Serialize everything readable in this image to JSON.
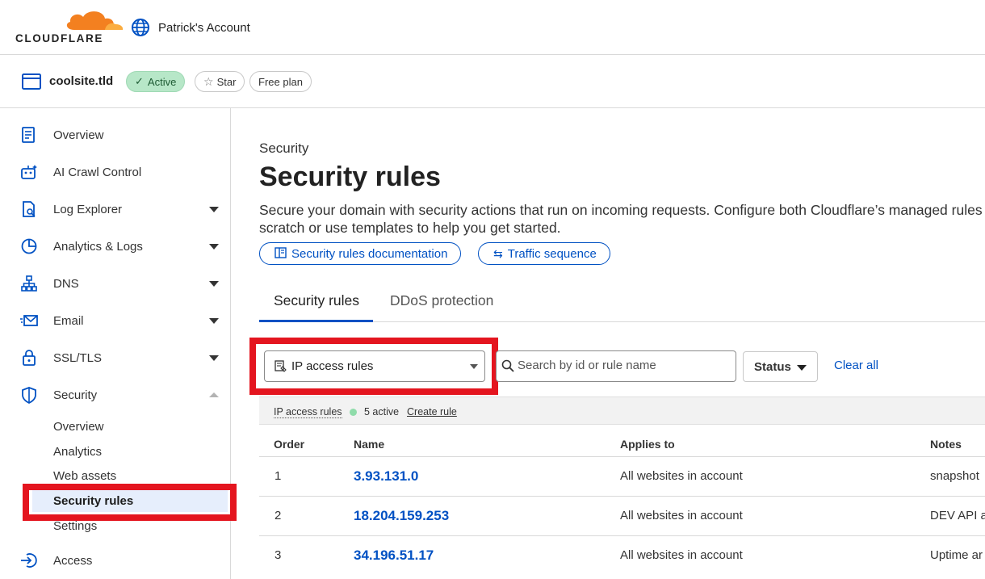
{
  "brand": {
    "logo_text": "CLOUDFLARE",
    "accent": "#f38020"
  },
  "account": {
    "name": "Patrick's Account",
    "icon": "globe-icon"
  },
  "zone": {
    "name": "coolsite.tld",
    "status": "Active",
    "star_label": "Star",
    "plan": "Free plan"
  },
  "sidebar": {
    "items": [
      {
        "label": "Overview",
        "icon": "document-icon"
      },
      {
        "label": "AI Crawl Control",
        "icon": "robot-icon"
      },
      {
        "label": "Log Explorer",
        "icon": "log-icon"
      },
      {
        "label": "Analytics & Logs",
        "icon": "pie-chart-icon"
      },
      {
        "label": "DNS",
        "icon": "network-icon"
      },
      {
        "label": "Email",
        "icon": "email-icon"
      },
      {
        "label": "SSL/TLS",
        "icon": "lock-icon"
      },
      {
        "label": "Security",
        "icon": "shield-icon"
      },
      {
        "label": "Access",
        "icon": "access-icon"
      }
    ],
    "security_sub": [
      "Overview",
      "Analytics",
      "Web assets",
      "Security rules",
      "Settings"
    ],
    "active_sub": "Security rules"
  },
  "page": {
    "breadcrumb": "Security",
    "title": "Security rules",
    "description_1": "Secure your domain with security actions that run on incoming requests. Configure both Cloudflare’s managed rules",
    "description_2": "scratch or use templates to help you get started.",
    "doc_button": "Security rules documentation",
    "traffic_button": "Traffic sequence"
  },
  "tabs": [
    "Security rules",
    "DDoS protection"
  ],
  "filters": {
    "rule_type": "IP access rules",
    "search_placeholder": "Search by id or rule name",
    "status_label": "Status",
    "clear_all": "Clear all"
  },
  "rules_bar": {
    "label": "IP access rules",
    "count": "5 active",
    "create": "Create rule"
  },
  "table": {
    "columns": [
      "Order",
      "Name",
      "Applies to",
      "Notes"
    ],
    "rows": [
      {
        "order": "1",
        "name": "3.93.131.0",
        "applies_to": "All websites in account",
        "notes": "snapshot"
      },
      {
        "order": "2",
        "name": "18.204.159.253",
        "applies_to": "All websites in account",
        "notes": "DEV API a"
      },
      {
        "order": "3",
        "name": "34.196.51.17",
        "applies_to": "All websites in account",
        "notes": "Uptime ar"
      }
    ]
  },
  "colors": {
    "link": "#0051c3",
    "highlight": "#e4151f",
    "active_badge": "#b7e7c8",
    "status_dot": "#8fdcaa"
  }
}
